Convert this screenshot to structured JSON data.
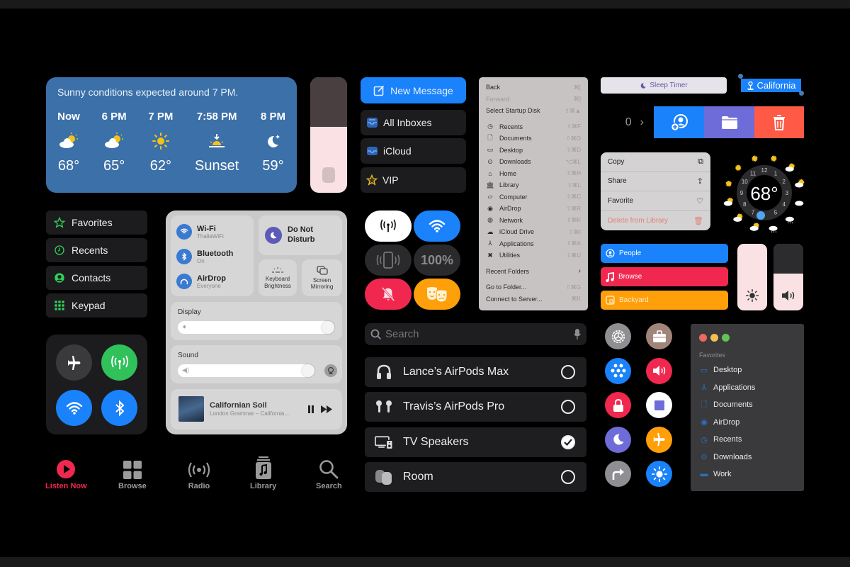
{
  "weather": {
    "headline": "Sunny conditions expected around 7 PM.",
    "forecast": [
      {
        "time": "Now",
        "icon": "partly-cloudy-icon",
        "temp": "68°"
      },
      {
        "time": "6 PM",
        "icon": "partly-cloudy-icon",
        "temp": "65°"
      },
      {
        "time": "7 PM",
        "icon": "sun-icon",
        "temp": "62°"
      },
      {
        "time": "7:58 PM",
        "icon": "sunset-icon",
        "temp": "Sunset"
      },
      {
        "time": "8 PM",
        "icon": "moon-stars-icon",
        "temp": "59°"
      }
    ]
  },
  "homepod_volume": {
    "level_percent": 57
  },
  "phone_sidebar": {
    "items": [
      {
        "label": "Favorites",
        "icon": "star-icon"
      },
      {
        "label": "Recents",
        "icon": "clock-icon"
      },
      {
        "label": "Contacts",
        "icon": "person-circle-icon"
      },
      {
        "label": "Keypad",
        "icon": "keypad-icon"
      }
    ]
  },
  "connectivity": {
    "airplane": "off",
    "cellular": "on",
    "wifi": "on",
    "bluetooth": "on"
  },
  "mac_control_center": {
    "wifi": {
      "title": "Wi-Fi",
      "sub": "ThaliaWiFi"
    },
    "bluetooth": {
      "title": "Bluetooth",
      "sub": "On"
    },
    "airdrop": {
      "title": "AirDrop",
      "sub": "Everyone"
    },
    "dnd": {
      "title_line1": "Do Not",
      "title_line2": "Disturb"
    },
    "keyboard": {
      "line1": "Keyboard",
      "line2": "Brightness"
    },
    "mirroring": {
      "line1": "Screen",
      "line2": "Mirroring"
    },
    "display_label": "Display",
    "display_level_percent": 100,
    "sound_label": "Sound",
    "sound_level_percent": 92,
    "now_playing": {
      "title": "Californian Soil",
      "artist": "London Grammar – California..."
    }
  },
  "music_tabs": [
    {
      "label": "Listen Now",
      "active": true
    },
    {
      "label": "Browse",
      "active": false
    },
    {
      "label": "Radio",
      "active": false
    },
    {
      "label": "Library",
      "active": false
    },
    {
      "label": "Search",
      "active": false
    }
  ],
  "mail": {
    "new_message": "New Message",
    "mailboxes": [
      {
        "label": "All Inboxes",
        "icon": "inbox-stack-icon"
      },
      {
        "label": "iCloud",
        "icon": "inbox-icon"
      },
      {
        "label": "VIP",
        "icon": "star-icon"
      }
    ]
  },
  "go_menu": {
    "top": [
      {
        "label": "Back",
        "shortcut": "⌘[",
        "disabled": false
      },
      {
        "label": "Forward",
        "shortcut": "⌘]",
        "disabled": true
      },
      {
        "label": "Select Startup Disk",
        "shortcut": "⇧⌘▲",
        "disabled": false
      }
    ],
    "places": [
      {
        "label": "Recents",
        "icon": "◷",
        "shortcut": "⇧⌘F"
      },
      {
        "label": "Documents",
        "icon": "🗋",
        "shortcut": "⇧⌘O"
      },
      {
        "label": "Desktop",
        "icon": "▭",
        "shortcut": "⇧⌘D"
      },
      {
        "label": "Downloads",
        "icon": "⊙",
        "shortcut": "⌥⌘L"
      },
      {
        "label": "Home",
        "icon": "⌂",
        "shortcut": "⇧⌘H"
      },
      {
        "label": "Library",
        "icon": "🏛",
        "shortcut": "⇧⌘L"
      },
      {
        "label": "Computer",
        "icon": "▱",
        "shortcut": "⇧⌘C"
      },
      {
        "label": "AirDrop",
        "icon": "◉",
        "shortcut": "⇧⌘R"
      },
      {
        "label": "Network",
        "icon": "◍",
        "shortcut": "⇧⌘K"
      },
      {
        "label": "iCloud Drive",
        "icon": "☁",
        "shortcut": "⇧⌘I"
      },
      {
        "label": "Applications",
        "icon": "⅄",
        "shortcut": "⇧⌘A"
      },
      {
        "label": "Utilities",
        "icon": "✖",
        "shortcut": "⇧⌘U"
      }
    ],
    "recent_folders": "Recent Folders",
    "go_to_folder": {
      "label": "Go to Folder...",
      "shortcut": "⇧⌘G"
    },
    "connect_server": {
      "label": "Connect to Server...",
      "shortcut": "⌘K"
    }
  },
  "control_pills": {
    "battery": "100%"
  },
  "airplay": {
    "search_placeholder": "Search",
    "devices": [
      {
        "name": "Lance’s AirPods Max",
        "icon": "headphones-icon",
        "selected": false
      },
      {
        "name": "Travis’s AirPods Pro",
        "icon": "airpods-icon",
        "selected": false
      },
      {
        "name": "TV Speakers",
        "icon": "tv-speaker-icon",
        "selected": true
      },
      {
        "name": "Room",
        "icon": "homepod-icon",
        "selected": false
      }
    ]
  },
  "sleep_timer": "Sleep Timer",
  "location_label": "California",
  "swipe_row": {
    "count": "0"
  },
  "context_menu": [
    {
      "label": "Copy",
      "icon": "copy-icon"
    },
    {
      "label": "Share",
      "icon": "share-icon"
    },
    {
      "label": "Favorite",
      "icon": "heart-icon"
    },
    {
      "label": "Delete from Library",
      "icon": "trash-icon"
    }
  ],
  "weather_dial": {
    "temp": "68°",
    "hours": [
      "12",
      "1",
      "2",
      "3",
      "4",
      "5",
      "7",
      "8",
      "9",
      "10",
      "11"
    ]
  },
  "shortcuts": [
    {
      "label": "People",
      "color": "#1a82fb",
      "icon": "person-circle-icon"
    },
    {
      "label": "Browse",
      "color": "#f0284f",
      "icon": "music-note-icon"
    },
    {
      "label": "Backyard",
      "color": "#ff9f0a",
      "icon": "photo-icon"
    }
  ],
  "brightness_slider": {
    "level_percent": 100
  },
  "volume_slider": {
    "level_percent": 55
  },
  "circle_icons": [
    {
      "name": "settings-gear-icon",
      "color": "#8e8e93"
    },
    {
      "name": "briefcase-icon",
      "color": "#a2857a"
    },
    {
      "name": "dots-grid-icon",
      "color": "#1a82fb"
    },
    {
      "name": "speaker-icon",
      "color": "#f0284f"
    },
    {
      "name": "lock-icon",
      "color": "#f0284f"
    },
    {
      "name": "stop-icon",
      "color": "#ffffff"
    },
    {
      "name": "moon-icon",
      "color": "#6e6cd8"
    },
    {
      "name": "airplane-icon",
      "color": "#ff9f0a"
    },
    {
      "name": "forward-arrow-icon",
      "color": "#8e8e93"
    },
    {
      "name": "sun-icon",
      "color": "#1a82fb"
    }
  ],
  "finder_sidebar": {
    "section": "Favorites",
    "items": [
      {
        "label": "Desktop"
      },
      {
        "label": "Applications"
      },
      {
        "label": "Documents"
      },
      {
        "label": "AirDrop"
      },
      {
        "label": "Recents"
      },
      {
        "label": "Downloads"
      },
      {
        "label": "Work"
      }
    ]
  }
}
